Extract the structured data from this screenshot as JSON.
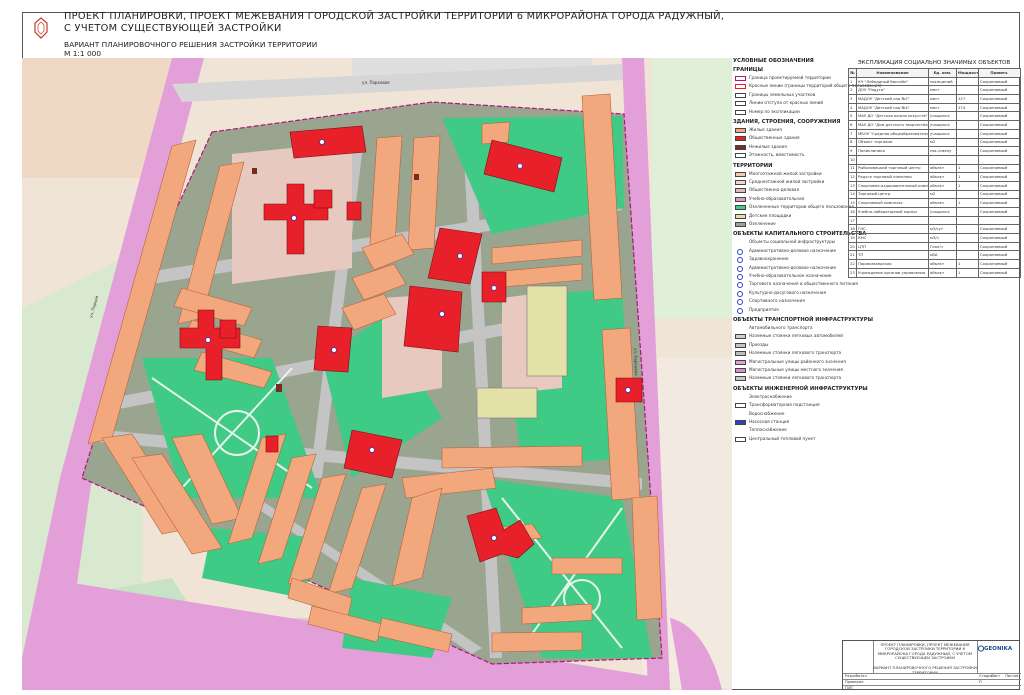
{
  "header": {
    "title_line1": "ПРОЕКТ ПЛАНИРОВКИ, ПРОЕКТ МЕЖЕВАНИЯ ГОРОДСКОЙ ЗАСТРОЙКИ ТЕРРИТОРИИ 6 МИКРОРАЙОНА ГОРОДА РАДУЖНЫЙ,",
    "title_line2": "С УЧЕТОМ СУЩЕСТВУЮЩЕЙ ЗАСТРОЙКИ",
    "subtitle": "ВАРИАНТ ПЛАНИРОВОЧНОГО РЕШЕНИЯ ЗАСТРОЙКИ ТЕРРИТОРИИ",
    "scale": "М 1:1 000"
  },
  "colors": {
    "residential": "#f3a77c",
    "public": "#e8202a",
    "green": "#3fca86",
    "courtyard": "#9aa58f",
    "road": "#c4c4c4",
    "boundary": "#e3a0d8",
    "pale_courtyard": "#e8c9c0",
    "sport": "#e3e1a8",
    "outside_green": "#c7e2c4"
  },
  "map_labels": {
    "street_top": "ул. Парковая",
    "street_right": "ул. Парковая",
    "street_left": "ул. Первая"
  },
  "legend": {
    "title": "УСЛОВНЫЕ ОБОЗНАЧЕНИЯ",
    "sections": [
      {
        "head": "ГРАНИЦЫ",
        "items": [
          {
            "label": "Граница проектируемой территории",
            "swatch": "#ffffff",
            "icon": "boundary-line"
          },
          {
            "label": "Красные линии (границы территорий общего пользования)",
            "swatch": "#ffffff",
            "icon": "red-line"
          },
          {
            "label": "Границы земельных участков",
            "swatch": "#ffffff",
            "icon": "parcel-line"
          },
          {
            "label": "Линии отступа от красных линий",
            "swatch": "#ffffff",
            "icon": "setback-line"
          },
          {
            "label": "Номер по экспликации",
            "swatch": "#ffffff",
            "icon": "number-marker"
          }
        ]
      },
      {
        "head": "ЗДАНИЯ, СТРОЕНИЯ, СООРУЖЕНИЯ",
        "items": [
          {
            "label": "Жилые здания",
            "swatch": "#f3a77c",
            "icon": "swatch"
          },
          {
            "label": "Общественные здания",
            "swatch": "#e8202a",
            "icon": "swatch"
          },
          {
            "label": "Нежилые здания",
            "swatch": "#7a2a22",
            "icon": "swatch"
          },
          {
            "label": "Этажность, вместимость",
            "swatch": "#ffffff",
            "icon": "storey-marker"
          }
        ]
      },
      {
        "head": "ТЕРРИТОРИИ",
        "items": [
          {
            "label": "Многоэтажной жилой застройки",
            "swatch": "#f7c9b0",
            "icon": "swatch"
          },
          {
            "label": "Среднеэтажной жилой застройки",
            "swatch": "#eed8cf",
            "icon": "swatch"
          },
          {
            "label": "Общественно-деловая",
            "swatch": "#e6b9bf",
            "icon": "swatch"
          },
          {
            "label": "Учебно-образовательная",
            "swatch": "#d3a0b8",
            "icon": "swatch"
          },
          {
            "label": "Озелененные территории общего пользования",
            "swatch": "#3fca86",
            "icon": "swatch"
          },
          {
            "label": "Детские площадки",
            "swatch": "#e3e1a8",
            "icon": "swatch"
          },
          {
            "label": "Озеленение",
            "swatch": "#9aa58f",
            "icon": "swatch"
          }
        ]
      },
      {
        "head": "ОБЪЕКТЫ КАПИТАЛЬНОГО СТРОИТЕЛЬСТВА",
        "items": [
          {
            "label": "Объекты социальной инфраструктуры",
            "swatch": "#ffffff",
            "icon": "none"
          },
          {
            "label": "Административно-деловое назначение",
            "swatch": "#ffffff",
            "icon": "circle-marker"
          },
          {
            "label": "Здравоохранение",
            "swatch": "#ffffff",
            "icon": "circle-marker"
          },
          {
            "label": "Административно-деловое назначение",
            "swatch": "#ffffff",
            "icon": "circle-marker"
          },
          {
            "label": "Учебно-образовательное назначение",
            "swatch": "#ffffff",
            "icon": "circle-marker"
          },
          {
            "label": "Торгового назначения и общественного питания",
            "swatch": "#ffffff",
            "icon": "circle-marker"
          },
          {
            "label": "Культурно-досугового назначения",
            "swatch": "#ffffff",
            "icon": "circle-marker"
          },
          {
            "label": "Спортивного назначения",
            "swatch": "#ffffff",
            "icon": "circle-marker"
          },
          {
            "label": "Предприятия",
            "swatch": "#ffffff",
            "icon": "circle-marker"
          }
        ]
      },
      {
        "head": "ОБЪЕКТЫ ТРАНСПОРТНОЙ ИНФРАСТРУКТУРЫ",
        "items": [
          {
            "label": "Автомобильного транспорта",
            "swatch": "#ffffff",
            "icon": "none"
          },
          {
            "label": "Наземные стоянки легковых автомобилей",
            "swatch": "#cfcfcf",
            "icon": "swatch"
          },
          {
            "label": "Проезды",
            "swatch": "#c4c4c4",
            "icon": "swatch"
          },
          {
            "label": "Наземные стоянки легкового транспорта",
            "swatch": "#bdbdbd",
            "icon": "swatch"
          },
          {
            "label": "Магистральные улицы районного значения",
            "swatch": "#e3a0d8",
            "icon": "swatch"
          },
          {
            "label": "Магистральные улицы местного значения",
            "swatch": "#d98fcc",
            "icon": "swatch"
          },
          {
            "label": "Наземные стоянки легкового транспорта",
            "swatch": "#c9c9c9",
            "icon": "swatch"
          }
        ]
      },
      {
        "head": "ОБЪЕКТЫ ИНЖЕНЕРНОЙ ИНФРАСТРУКТУРЫ",
        "items": [
          {
            "label": "Электроснабжение",
            "swatch": "#ffffff",
            "icon": "none"
          },
          {
            "label": "Трансформаторная подстанция",
            "swatch": "#ffffff",
            "icon": "square-marker"
          },
          {
            "label": "Водоснабжение",
            "swatch": "#ffffff",
            "icon": "none"
          },
          {
            "label": "Насосная станция",
            "swatch": "#2a40c8",
            "icon": "square-marker"
          },
          {
            "label": "Теплоснабжение",
            "swatch": "#ffffff",
            "icon": "none"
          },
          {
            "label": "Центральный тепловой пункт",
            "swatch": "#ffffff",
            "icon": "square-marker"
          }
        ]
      }
    ]
  },
  "explication": {
    "title": "ЭКСПЛИКАЦИЯ СОЦИАЛЬНО ЗНАЧИМЫХ ОБЪЕКТОВ",
    "columns": [
      "№",
      "Наименование",
      "Ед. изм.",
      "Мощность",
      "Примеч."
    ],
    "rows": [
      [
        "1",
        "КЧ \"Лебединый бассейн\"",
        "посещений",
        "",
        "Сохраняемый"
      ],
      [
        "2",
        "ДОУ \"Радуга\"",
        "мест",
        "",
        "Сохраняемый"
      ],
      [
        "3",
        "МАДОУ \"Детский сад №2\"",
        "мест",
        "227",
        "Сохраняемый"
      ],
      [
        "4",
        "МАДОУ \"Детский сад №4\"",
        "мест",
        "274",
        "Сохраняемый"
      ],
      [
        "5",
        "МАУ ДО \"Детская школа искусств\"",
        "учащихся",
        "",
        "Сохраняемый"
      ],
      [
        "6",
        "МАУ ДО \"Дом детского творчества\"",
        "учащихся",
        "",
        "Сохраняемый"
      ],
      [
        "7",
        "МБОУ \"Средняя общеобразовательная школа №3\"",
        "учащихся",
        "",
        "Сохраняемый"
      ],
      [
        "8",
        "Объект торговли",
        "м2",
        "",
        "Сохраняемый"
      ],
      [
        "9",
        "Поликлиника",
        "пос./смену",
        "",
        "Сохраняемый"
      ],
      [
        "10",
        "",
        "",
        "",
        ""
      ],
      [
        "11",
        "Рыболовецкий торговый центр",
        "объект",
        "1",
        "Сохраняемый"
      ],
      [
        "12",
        "Радуга торговый комплекс",
        "объект",
        "1",
        "Сохраняемый"
      ],
      [
        "13",
        "Спортивно-оздоровительный комплекс",
        "объект",
        "1",
        "Сохраняемый"
      ],
      [
        "14",
        "Торговый центр",
        "м2",
        "",
        "Сохраняемый"
      ],
      [
        "15",
        "Спортивный комплекс",
        "объект",
        "1",
        "Сохраняемый"
      ],
      [
        "16",
        "Учебно-лабораторный корпус",
        "учащихся",
        "",
        "Сохраняемый"
      ],
      [
        "17",
        "",
        "",
        "",
        ""
      ],
      [
        "18",
        "ГНС",
        "м3/сут",
        "",
        "Сохраняемый"
      ],
      [
        "19",
        "КНС",
        "м3/ч",
        "",
        "Сохраняемый"
      ],
      [
        "20",
        "ЦТП",
        "Гкал/ч",
        "",
        "Сохраняемый"
      ],
      [
        "21",
        "ТП",
        "кВА",
        "",
        "Сохраняемый"
      ],
      [
        "22",
        "Парикмахерская",
        "объект",
        "1",
        "Сохраняемый"
      ],
      [
        "23",
        "Учреждение органов управления",
        "объект",
        "1",
        "Сохраняемый"
      ]
    ]
  },
  "stamp": {
    "project_title": "ПРОЕКТ ПЛАНИРОВКИ, ПРОЕКТ МЕЖЕВАНИЯ ГОРОДСКОЙ ЗАСТРОЙКИ ТЕРРИТОРИИ 6 МИКРОРАЙОНА ГОРОДА РАДУЖНЫЙ, С УЧЕТОМ СУЩЕСТВУЮЩЕЙ ЗАСТРОЙКИ",
    "sheet_title": "ВАРИАНТ ПЛАНИРОВОЧНОГО РЕШЕНИЯ ЗАСТРОЙКИ ТЕРРИТОРИИ",
    "brand": "GEONIKA",
    "rows": [
      {
        "role": "Разработал",
        "name": "",
        "col3": "Стадия",
        "col4": "Лист",
        "col5": "Листов"
      },
      {
        "role": "Проверил",
        "name": "",
        "col3": "П",
        "col4": "",
        "col5": ""
      },
      {
        "role": "ГИП",
        "name": "",
        "col3": "",
        "col4": "",
        "col5": ""
      }
    ]
  }
}
